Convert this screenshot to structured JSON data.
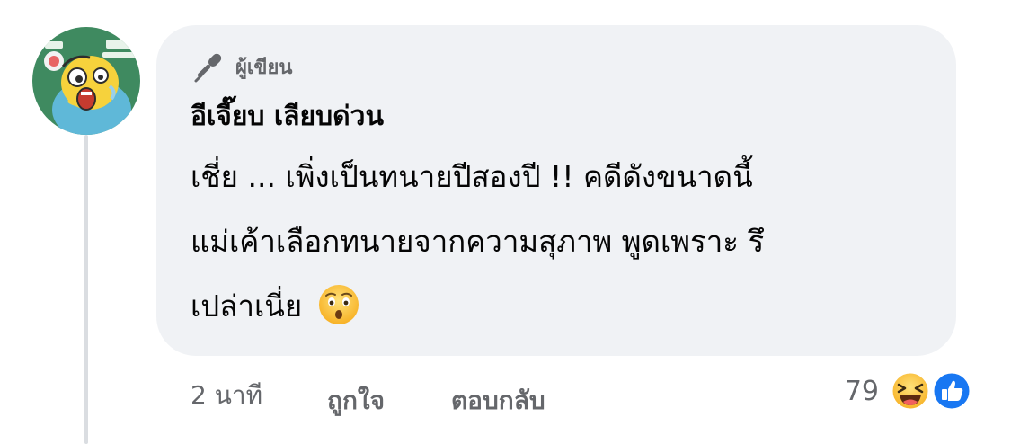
{
  "comment": {
    "author_badge": {
      "icon": "microphone-icon",
      "label": "ผู้เขียน"
    },
    "author_name": "อีเจี๊ยบ เลียบด่วน",
    "text_lines": [
      "เชี่ย ... เพิ่งเป็นทนายปีสองปี !! คดีดังขนาดนี้",
      "แม่เค้าเลือกทนายจากความสุภาพ พูดเพราะ รึ",
      "เปล่าเนี่ย"
    ],
    "emoji": "astonished-face-emoji"
  },
  "actions": {
    "timestamp": "2 นาที",
    "like_label": "ถูกใจ",
    "reply_label": "ตอบกลับ"
  },
  "reactions": {
    "count": "79",
    "types": [
      "haha-icon",
      "like-icon"
    ]
  },
  "colors": {
    "bubble": "#f0f2f5",
    "secondary_text": "#65676b",
    "primary_text": "#050505",
    "like_blue": "#1877f2",
    "emoji_yellow": "#f7b125"
  }
}
